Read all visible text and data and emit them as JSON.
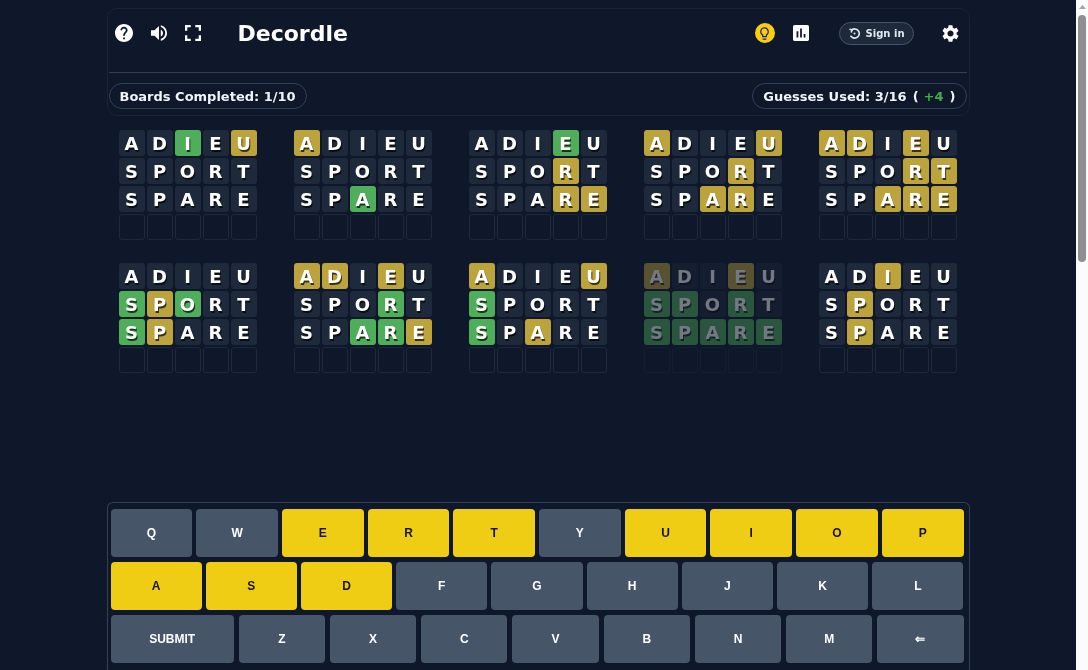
{
  "header": {
    "title": "Decordle",
    "sign_in": "Sign in"
  },
  "stats": {
    "boards_completed": "Boards Completed: 1/10",
    "guesses_used": [
      {
        "kind": "label",
        "text": "Guesses Used: 3/16"
      },
      {
        "kind": "plain",
        "text": "("
      },
      {
        "kind": "bonus",
        "text": "+4"
      },
      {
        "kind": "plain",
        "text": ")"
      }
    ]
  },
  "boards": [
    {
      "completed": false,
      "rows": [
        {
          "tiles": [
            {
              "letter": "A",
              "kind": "absent"
            },
            {
              "letter": "D",
              "kind": "absent"
            },
            {
              "letter": "I",
              "kind": "correct"
            },
            {
              "letter": "E",
              "kind": "absent"
            },
            {
              "letter": "U",
              "kind": "present"
            }
          ]
        },
        {
          "tiles": [
            {
              "letter": "S",
              "kind": "absent"
            },
            {
              "letter": "P",
              "kind": "absent"
            },
            {
              "letter": "O",
              "kind": "absent"
            },
            {
              "letter": "R",
              "kind": "absent"
            },
            {
              "letter": "T",
              "kind": "absent"
            }
          ]
        },
        {
          "tiles": [
            {
              "letter": "S",
              "kind": "absent"
            },
            {
              "letter": "P",
              "kind": "absent"
            },
            {
              "letter": "A",
              "kind": "absent"
            },
            {
              "letter": "R",
              "kind": "absent"
            },
            {
              "letter": "E",
              "kind": "absent"
            }
          ]
        },
        {
          "tiles": [
            {
              "kind": "empty"
            },
            {
              "kind": "empty"
            },
            {
              "kind": "empty"
            },
            {
              "kind": "empty"
            },
            {
              "kind": "empty"
            }
          ]
        }
      ]
    },
    {
      "completed": false,
      "rows": [
        {
          "tiles": [
            {
              "letter": "A",
              "kind": "present"
            },
            {
              "letter": "D",
              "kind": "absent"
            },
            {
              "letter": "I",
              "kind": "absent"
            },
            {
              "letter": "E",
              "kind": "absent"
            },
            {
              "letter": "U",
              "kind": "absent"
            }
          ]
        },
        {
          "tiles": [
            {
              "letter": "S",
              "kind": "absent"
            },
            {
              "letter": "P",
              "kind": "absent"
            },
            {
              "letter": "O",
              "kind": "absent"
            },
            {
              "letter": "R",
              "kind": "absent"
            },
            {
              "letter": "T",
              "kind": "absent"
            }
          ]
        },
        {
          "tiles": [
            {
              "letter": "S",
              "kind": "absent"
            },
            {
              "letter": "P",
              "kind": "absent"
            },
            {
              "letter": "A",
              "kind": "correct"
            },
            {
              "letter": "R",
              "kind": "absent"
            },
            {
              "letter": "E",
              "kind": "absent"
            }
          ]
        },
        {
          "tiles": [
            {
              "kind": "empty"
            },
            {
              "kind": "empty"
            },
            {
              "kind": "empty"
            },
            {
              "kind": "empty"
            },
            {
              "kind": "empty"
            }
          ]
        }
      ]
    },
    {
      "completed": false,
      "rows": [
        {
          "tiles": [
            {
              "letter": "A",
              "kind": "absent"
            },
            {
              "letter": "D",
              "kind": "absent"
            },
            {
              "letter": "I",
              "kind": "absent"
            },
            {
              "letter": "E",
              "kind": "correct"
            },
            {
              "letter": "U",
              "kind": "absent"
            }
          ]
        },
        {
          "tiles": [
            {
              "letter": "S",
              "kind": "absent"
            },
            {
              "letter": "P",
              "kind": "absent"
            },
            {
              "letter": "O",
              "kind": "absent"
            },
            {
              "letter": "R",
              "kind": "present"
            },
            {
              "letter": "T",
              "kind": "absent"
            }
          ]
        },
        {
          "tiles": [
            {
              "letter": "S",
              "kind": "absent"
            },
            {
              "letter": "P",
              "kind": "absent"
            },
            {
              "letter": "A",
              "kind": "absent"
            },
            {
              "letter": "R",
              "kind": "present"
            },
            {
              "letter": "E",
              "kind": "present"
            }
          ]
        },
        {
          "tiles": [
            {
              "kind": "empty"
            },
            {
              "kind": "empty"
            },
            {
              "kind": "empty"
            },
            {
              "kind": "empty"
            },
            {
              "kind": "empty"
            }
          ]
        }
      ]
    },
    {
      "completed": false,
      "rows": [
        {
          "tiles": [
            {
              "letter": "A",
              "kind": "present"
            },
            {
              "letter": "D",
              "kind": "absent"
            },
            {
              "letter": "I",
              "kind": "absent"
            },
            {
              "letter": "E",
              "kind": "absent"
            },
            {
              "letter": "U",
              "kind": "present"
            }
          ]
        },
        {
          "tiles": [
            {
              "letter": "S",
              "kind": "absent"
            },
            {
              "letter": "P",
              "kind": "absent"
            },
            {
              "letter": "O",
              "kind": "absent"
            },
            {
              "letter": "R",
              "kind": "present"
            },
            {
              "letter": "T",
              "kind": "absent"
            }
          ]
        },
        {
          "tiles": [
            {
              "letter": "S",
              "kind": "absent"
            },
            {
              "letter": "P",
              "kind": "absent"
            },
            {
              "letter": "A",
              "kind": "present"
            },
            {
              "letter": "R",
              "kind": "present"
            },
            {
              "letter": "E",
              "kind": "absent"
            }
          ]
        },
        {
          "tiles": [
            {
              "kind": "empty"
            },
            {
              "kind": "empty"
            },
            {
              "kind": "empty"
            },
            {
              "kind": "empty"
            },
            {
              "kind": "empty"
            }
          ]
        }
      ]
    },
    {
      "completed": false,
      "rows": [
        {
          "tiles": [
            {
              "letter": "A",
              "kind": "present"
            },
            {
              "letter": "D",
              "kind": "present"
            },
            {
              "letter": "I",
              "kind": "absent"
            },
            {
              "letter": "E",
              "kind": "present"
            },
            {
              "letter": "U",
              "kind": "absent"
            }
          ]
        },
        {
          "tiles": [
            {
              "letter": "S",
              "kind": "absent"
            },
            {
              "letter": "P",
              "kind": "absent"
            },
            {
              "letter": "O",
              "kind": "absent"
            },
            {
              "letter": "R",
              "kind": "present"
            },
            {
              "letter": "T",
              "kind": "present"
            }
          ]
        },
        {
          "tiles": [
            {
              "letter": "S",
              "kind": "absent"
            },
            {
              "letter": "P",
              "kind": "absent"
            },
            {
              "letter": "A",
              "kind": "present"
            },
            {
              "letter": "R",
              "kind": "present"
            },
            {
              "letter": "E",
              "kind": "present"
            }
          ]
        },
        {
          "tiles": [
            {
              "kind": "empty"
            },
            {
              "kind": "empty"
            },
            {
              "kind": "empty"
            },
            {
              "kind": "empty"
            },
            {
              "kind": "empty"
            }
          ]
        }
      ]
    },
    {
      "completed": false,
      "rows": [
        {
          "tiles": [
            {
              "letter": "A",
              "kind": "absent"
            },
            {
              "letter": "D",
              "kind": "absent"
            },
            {
              "letter": "I",
              "kind": "absent"
            },
            {
              "letter": "E",
              "kind": "absent"
            },
            {
              "letter": "U",
              "kind": "absent"
            }
          ]
        },
        {
          "tiles": [
            {
              "letter": "S",
              "kind": "correct"
            },
            {
              "letter": "P",
              "kind": "present"
            },
            {
              "letter": "O",
              "kind": "correct"
            },
            {
              "letter": "R",
              "kind": "absent"
            },
            {
              "letter": "T",
              "kind": "absent"
            }
          ]
        },
        {
          "tiles": [
            {
              "letter": "S",
              "kind": "correct"
            },
            {
              "letter": "P",
              "kind": "present"
            },
            {
              "letter": "A",
              "kind": "absent"
            },
            {
              "letter": "R",
              "kind": "absent"
            },
            {
              "letter": "E",
              "kind": "absent"
            }
          ]
        },
        {
          "tiles": [
            {
              "kind": "empty"
            },
            {
              "kind": "empty"
            },
            {
              "kind": "empty"
            },
            {
              "kind": "empty"
            },
            {
              "kind": "empty"
            }
          ]
        }
      ]
    },
    {
      "completed": false,
      "rows": [
        {
          "tiles": [
            {
              "letter": "A",
              "kind": "present"
            },
            {
              "letter": "D",
              "kind": "present"
            },
            {
              "letter": "I",
              "kind": "absent"
            },
            {
              "letter": "E",
              "kind": "present"
            },
            {
              "letter": "U",
              "kind": "absent"
            }
          ]
        },
        {
          "tiles": [
            {
              "letter": "S",
              "kind": "absent"
            },
            {
              "letter": "P",
              "kind": "absent"
            },
            {
              "letter": "O",
              "kind": "absent"
            },
            {
              "letter": "R",
              "kind": "correct"
            },
            {
              "letter": "T",
              "kind": "absent"
            }
          ]
        },
        {
          "tiles": [
            {
              "letter": "S",
              "kind": "absent"
            },
            {
              "letter": "P",
              "kind": "absent"
            },
            {
              "letter": "A",
              "kind": "correct"
            },
            {
              "letter": "R",
              "kind": "correct"
            },
            {
              "letter": "E",
              "kind": "present"
            }
          ]
        },
        {
          "tiles": [
            {
              "kind": "empty"
            },
            {
              "kind": "empty"
            },
            {
              "kind": "empty"
            },
            {
              "kind": "empty"
            },
            {
              "kind": "empty"
            }
          ]
        }
      ]
    },
    {
      "completed": false,
      "rows": [
        {
          "tiles": [
            {
              "letter": "A",
              "kind": "present"
            },
            {
              "letter": "D",
              "kind": "absent"
            },
            {
              "letter": "I",
              "kind": "absent"
            },
            {
              "letter": "E",
              "kind": "absent"
            },
            {
              "letter": "U",
              "kind": "present"
            }
          ]
        },
        {
          "tiles": [
            {
              "letter": "S",
              "kind": "correct"
            },
            {
              "letter": "P",
              "kind": "absent"
            },
            {
              "letter": "O",
              "kind": "absent"
            },
            {
              "letter": "R",
              "kind": "absent"
            },
            {
              "letter": "T",
              "kind": "absent"
            }
          ]
        },
        {
          "tiles": [
            {
              "letter": "S",
              "kind": "correct"
            },
            {
              "letter": "P",
              "kind": "absent"
            },
            {
              "letter": "A",
              "kind": "present"
            },
            {
              "letter": "R",
              "kind": "absent"
            },
            {
              "letter": "E",
              "kind": "absent"
            }
          ]
        },
        {
          "tiles": [
            {
              "kind": "empty"
            },
            {
              "kind": "empty"
            },
            {
              "kind": "empty"
            },
            {
              "kind": "empty"
            },
            {
              "kind": "empty"
            }
          ]
        }
      ]
    },
    {
      "completed": true,
      "rows": [
        {
          "tiles": [
            {
              "letter": "A",
              "kind": "present"
            },
            {
              "letter": "D",
              "kind": "absent"
            },
            {
              "letter": "I",
              "kind": "absent"
            },
            {
              "letter": "E",
              "kind": "present"
            },
            {
              "letter": "U",
              "kind": "absent"
            }
          ]
        },
        {
          "tiles": [
            {
              "letter": "S",
              "kind": "correct"
            },
            {
              "letter": "P",
              "kind": "correct"
            },
            {
              "letter": "O",
              "kind": "absent"
            },
            {
              "letter": "R",
              "kind": "correct"
            },
            {
              "letter": "T",
              "kind": "absent"
            }
          ]
        },
        {
          "tiles": [
            {
              "letter": "S",
              "kind": "correct"
            },
            {
              "letter": "P",
              "kind": "correct"
            },
            {
              "letter": "A",
              "kind": "correct"
            },
            {
              "letter": "R",
              "kind": "correct"
            },
            {
              "letter": "E",
              "kind": "correct"
            }
          ]
        },
        {
          "tiles": [
            {
              "kind": "empty"
            },
            {
              "kind": "empty"
            },
            {
              "kind": "empty"
            },
            {
              "kind": "empty"
            },
            {
              "kind": "empty"
            }
          ]
        }
      ]
    },
    {
      "completed": false,
      "rows": [
        {
          "tiles": [
            {
              "letter": "A",
              "kind": "absent"
            },
            {
              "letter": "D",
              "kind": "absent"
            },
            {
              "letter": "I",
              "kind": "present"
            },
            {
              "letter": "E",
              "kind": "absent"
            },
            {
              "letter": "U",
              "kind": "absent"
            }
          ]
        },
        {
          "tiles": [
            {
              "letter": "S",
              "kind": "absent"
            },
            {
              "letter": "P",
              "kind": "present"
            },
            {
              "letter": "O",
              "kind": "absent"
            },
            {
              "letter": "R",
              "kind": "absent"
            },
            {
              "letter": "T",
              "kind": "absent"
            }
          ]
        },
        {
          "tiles": [
            {
              "letter": "S",
              "kind": "absent"
            },
            {
              "letter": "P",
              "kind": "present"
            },
            {
              "letter": "A",
              "kind": "absent"
            },
            {
              "letter": "R",
              "kind": "absent"
            },
            {
              "letter": "E",
              "kind": "absent"
            }
          ]
        },
        {
          "tiles": [
            {
              "kind": "empty"
            },
            {
              "kind": "empty"
            },
            {
              "kind": "empty"
            },
            {
              "kind": "empty"
            },
            {
              "kind": "empty"
            }
          ]
        }
      ]
    }
  ],
  "keyboard": {
    "rows": [
      {
        "keys": [
          {
            "label": "Q",
            "kind": "letter",
            "guessed": false
          },
          {
            "label": "W",
            "kind": "letter",
            "guessed": false
          },
          {
            "label": "E",
            "kind": "letter",
            "guessed": true
          },
          {
            "label": "R",
            "kind": "letter",
            "guessed": true
          },
          {
            "label": "T",
            "kind": "letter",
            "guessed": true
          },
          {
            "label": "Y",
            "kind": "letter",
            "guessed": false
          },
          {
            "label": "U",
            "kind": "letter",
            "guessed": true
          },
          {
            "label": "I",
            "kind": "letter",
            "guessed": true
          },
          {
            "label": "O",
            "kind": "letter",
            "guessed": true
          },
          {
            "label": "P",
            "kind": "letter",
            "guessed": true
          }
        ]
      },
      {
        "keys": [
          {
            "label": "A",
            "kind": "letter",
            "guessed": true
          },
          {
            "label": "S",
            "kind": "letter",
            "guessed": true
          },
          {
            "label": "D",
            "kind": "letter",
            "guessed": true
          },
          {
            "label": "F",
            "kind": "letter",
            "guessed": false
          },
          {
            "label": "G",
            "kind": "letter",
            "guessed": false
          },
          {
            "label": "H",
            "kind": "letter",
            "guessed": false
          },
          {
            "label": "J",
            "kind": "letter",
            "guessed": false
          },
          {
            "label": "K",
            "kind": "letter",
            "guessed": false
          },
          {
            "label": "L",
            "kind": "letter",
            "guessed": false
          }
        ]
      },
      {
        "keys": [
          {
            "label": "SUBMIT",
            "kind": "submit",
            "guessed": false
          },
          {
            "label": "Z",
            "kind": "letter",
            "guessed": false
          },
          {
            "label": "X",
            "kind": "letter",
            "guessed": false
          },
          {
            "label": "C",
            "kind": "letter",
            "guessed": false
          },
          {
            "label": "V",
            "kind": "letter",
            "guessed": false
          },
          {
            "label": "B",
            "kind": "letter",
            "guessed": false
          },
          {
            "label": "N",
            "kind": "letter",
            "guessed": false
          },
          {
            "label": "M",
            "kind": "letter",
            "guessed": false
          },
          {
            "label": "⇐",
            "kind": "backspace",
            "guessed": false
          }
        ]
      }
    ]
  }
}
